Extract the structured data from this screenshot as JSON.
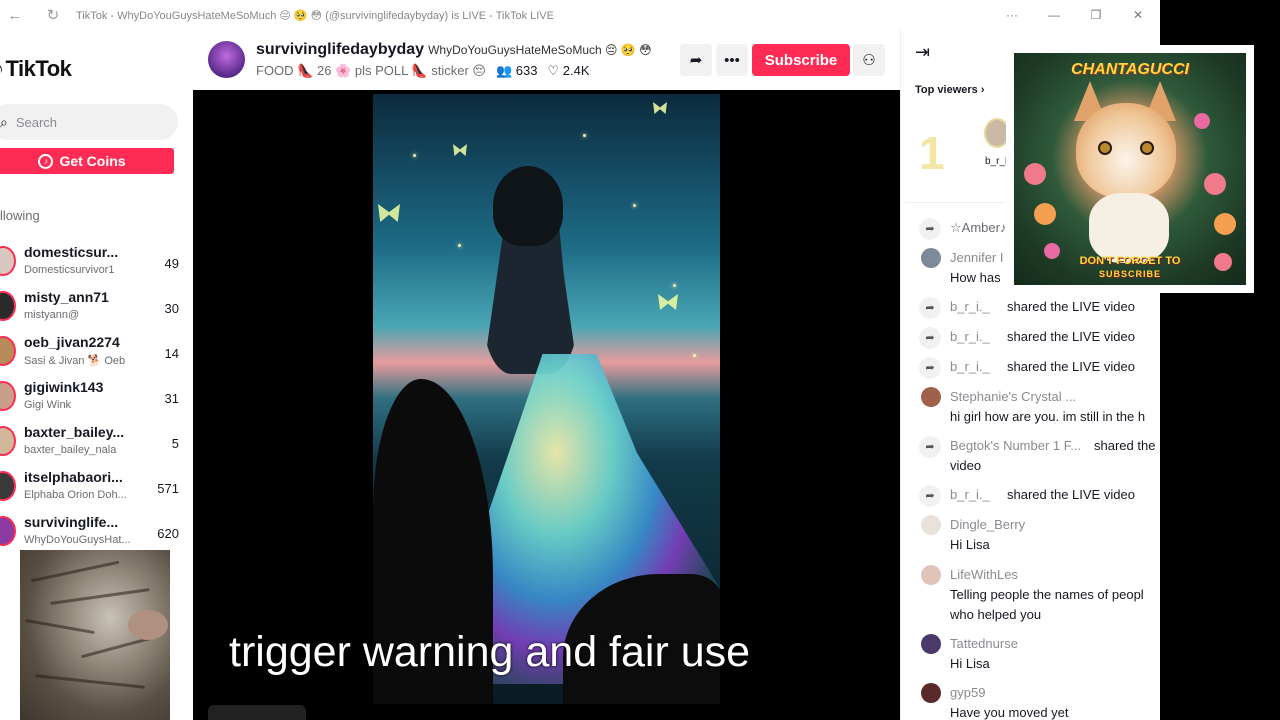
{
  "window": {
    "title": "TikTok - WhyDoYouGuysHateMeSoMuch 😔 🥺 😳 (@survivinglifedaybyday) is LIVE - TikTok LIVE"
  },
  "sidebar": {
    "logo_text": "TikTok",
    "search_placeholder": "Search",
    "get_coins_label": "Get Coins",
    "following_heading": "llowing",
    "following": [
      {
        "name": "domesticsur...",
        "sub": "Domesticsurvivor1",
        "count": "49"
      },
      {
        "name": "misty_ann71",
        "sub": "mistyann@",
        "count": "30"
      },
      {
        "name": "oeb_jivan2274",
        "sub": "Sasi & Jivan 🐕 Oeb",
        "count": "14"
      },
      {
        "name": "gigiwink143",
        "sub": "Gigi Wink",
        "count": "31"
      },
      {
        "name": "baxter_bailey...",
        "sub": "baxter_bailey_nala",
        "count": "5"
      },
      {
        "name": "itselphabaori...",
        "sub": "Elphaba Orion Doh...",
        "count": "571"
      },
      {
        "name": "survivinglife...",
        "sub": "WhyDoYouGuysHat...",
        "count": "620"
      }
    ]
  },
  "header": {
    "username": "survivinglifedaybyday",
    "live_title": "WhyDoYouGuysHateMeSoMuch 😔 🥺 😳",
    "tags": "FOOD 👠 26 🌸 pls POLL 👠 sticker 😔",
    "viewers": "633",
    "likes": "2.4K",
    "subscribe_label": "Subscribe"
  },
  "video": {
    "caption": "trigger warning and fair use"
  },
  "right_panel": {
    "top_viewers_label": "Top viewers",
    "top_rank": "1",
    "top_viewer_name": "b_r_i",
    "comments": [
      {
        "kind": "share",
        "user": "☆Amber♪",
        "text": ""
      },
      {
        "kind": "comment",
        "user": "Jennifer I",
        "text": "How has"
      },
      {
        "kind": "share",
        "user": "b_r_i._",
        "text": "shared the LIVE video"
      },
      {
        "kind": "share",
        "user": "b_r_i._",
        "text": "shared the LIVE video"
      },
      {
        "kind": "share",
        "user": "b_r_i._",
        "text": "shared the LIVE video"
      },
      {
        "kind": "comment",
        "user": "Stephanie's Crystal ...",
        "text": "hi girl how are you. im still in the h"
      },
      {
        "kind": "share",
        "user": "Begtok's Number 1 F...",
        "text": "shared the",
        "text2": "video"
      },
      {
        "kind": "share",
        "user": "b_r_i._",
        "text": "shared the LIVE video"
      },
      {
        "kind": "comment",
        "user": "Dingle_Berry",
        "text": "Hi Lisa"
      },
      {
        "kind": "comment",
        "user": "LifeWithLes",
        "text": "Telling people the names of peopl",
        "text2": "who helped you"
      },
      {
        "kind": "comment",
        "user": "Tattednurse",
        "text": "Hi Lisa"
      },
      {
        "kind": "comment",
        "user": "gyp59",
        "text": "Have you moved yet"
      }
    ]
  },
  "promo": {
    "top_text": "CHANTAGUCCI",
    "bottom_line1": "DON'T FORGET TO",
    "bottom_line2": "SUBSCRIBE"
  },
  "colors": {
    "brand": "#fe2c55",
    "text": "#161823",
    "muted": "#8a8b91"
  }
}
